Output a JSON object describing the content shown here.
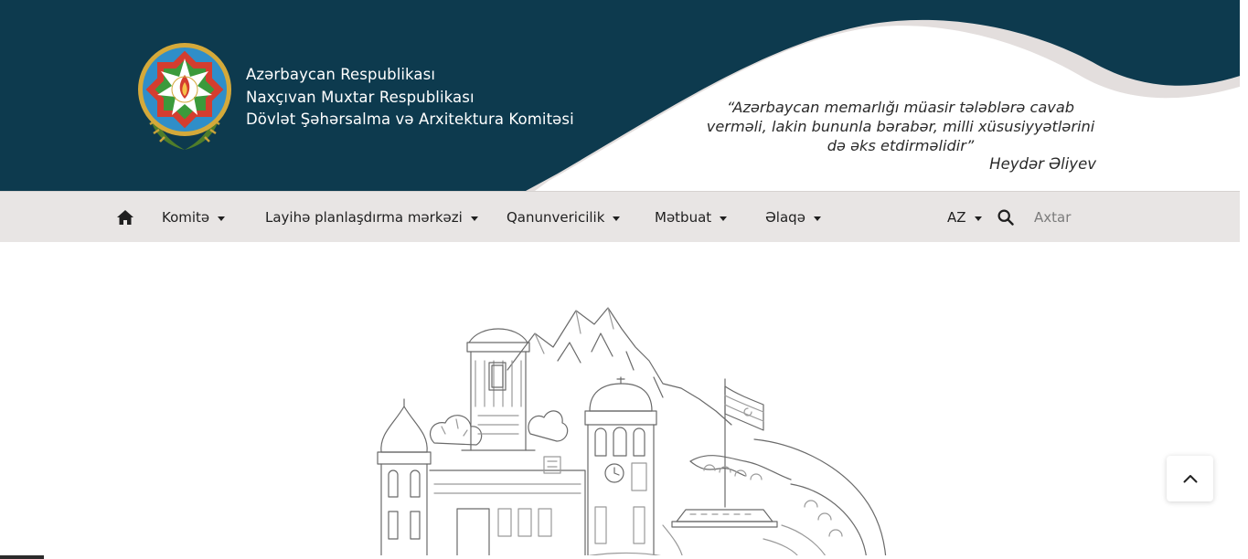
{
  "header": {
    "title_lines": [
      "Azərbaycan  Respublikası",
      "Naxçıvan Muxtar Respublikası",
      "Dövlət Şəhərsalma və Arxitektura Komitəsi"
    ],
    "quote_lines": [
      "“Azərbaycan memarlığı müasir tələblərə cavab",
      "verməli, lakin bununla bərabər, milli xüsusiyyətlərini",
      "də əks etdirməlidir”"
    ],
    "quote_author": "Heydər Əliyev",
    "emblem_icon": "azerbaijan-state-emblem",
    "colors": {
      "header_bg": "#0d3a4e",
      "wave": "#e3dedd",
      "nav_bg": "#e8e5e4"
    }
  },
  "nav": {
    "home_icon": "home-icon",
    "items": [
      {
        "label": "Komitə"
      },
      {
        "label": "Layihə planlaşdırma mərkəzi"
      },
      {
        "label": "Qanunvericilik"
      },
      {
        "label": "Mətbuat"
      },
      {
        "label": "Əlaqə"
      }
    ],
    "language": "AZ",
    "search_icon": "search-icon",
    "search_placeholder": "Axtar"
  },
  "main": {
    "illustration": "nakhchivan-landmarks-sketch",
    "scroll_top_icon": "chevron-up-icon"
  }
}
